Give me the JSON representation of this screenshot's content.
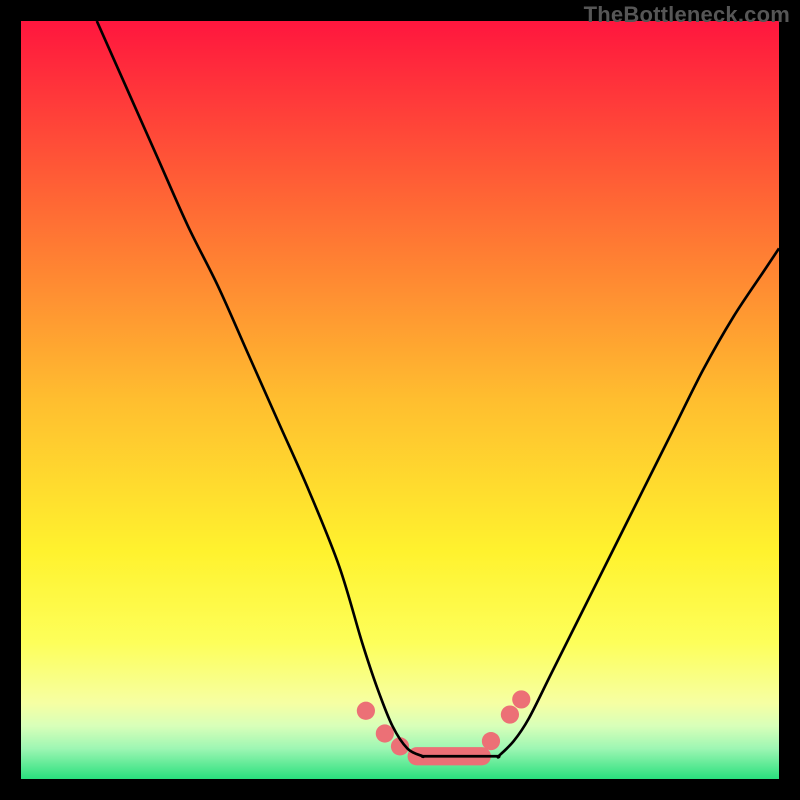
{
  "watermark": "TheBottleneck.com",
  "chart_data": {
    "type": "line",
    "title": "",
    "xlabel": "",
    "ylabel": "",
    "xlim": [
      0,
      100
    ],
    "ylim": [
      0,
      100
    ],
    "annotations": [],
    "series": [
      {
        "name": "curve-left",
        "x": [
          10,
          14,
          18,
          22,
          26,
          30,
          34,
          38,
          42,
          45,
          47,
          49,
          51,
          53
        ],
        "y": [
          100,
          91,
          82,
          73,
          65,
          56,
          47,
          38,
          28,
          18,
          12,
          7,
          4,
          3
        ]
      },
      {
        "name": "plateau",
        "x": [
          53,
          55,
          57,
          59,
          61,
          63
        ],
        "y": [
          3,
          3,
          3,
          3,
          3,
          3
        ]
      },
      {
        "name": "curve-right",
        "x": [
          63,
          65,
          67,
          70,
          74,
          78,
          82,
          86,
          90,
          94,
          98,
          100
        ],
        "y": [
          3,
          5,
          8,
          14,
          22,
          30,
          38,
          46,
          54,
          61,
          67,
          70
        ]
      }
    ],
    "background_gradient_stops": [
      {
        "pos": 0.0,
        "color": "#ff163e"
      },
      {
        "pos": 0.25,
        "color": "#ff6b34"
      },
      {
        "pos": 0.5,
        "color": "#ffbe2f"
      },
      {
        "pos": 0.7,
        "color": "#fff22e"
      },
      {
        "pos": 0.82,
        "color": "#fdff5a"
      },
      {
        "pos": 0.9,
        "color": "#f6ffa3"
      },
      {
        "pos": 0.93,
        "color": "#d8ffb9"
      },
      {
        "pos": 0.96,
        "color": "#9df6b3"
      },
      {
        "pos": 1.0,
        "color": "#29e07d"
      }
    ],
    "markers": [
      {
        "x": 45.5,
        "y": 9.0,
        "r": 1.2
      },
      {
        "x": 48.0,
        "y": 6.0,
        "r": 1.2
      },
      {
        "x": 50.0,
        "y": 4.3,
        "r": 1.2
      },
      {
        "x": 62.0,
        "y": 5.0,
        "r": 1.2
      },
      {
        "x": 64.5,
        "y": 8.5,
        "r": 1.2
      },
      {
        "x": 66.0,
        "y": 10.5,
        "r": 1.2
      }
    ],
    "plateau_bar": {
      "x0": 51,
      "x1": 62,
      "y": 3,
      "h": 2.4
    },
    "marker_color": "#ec7076",
    "curve_color": "#000000"
  }
}
